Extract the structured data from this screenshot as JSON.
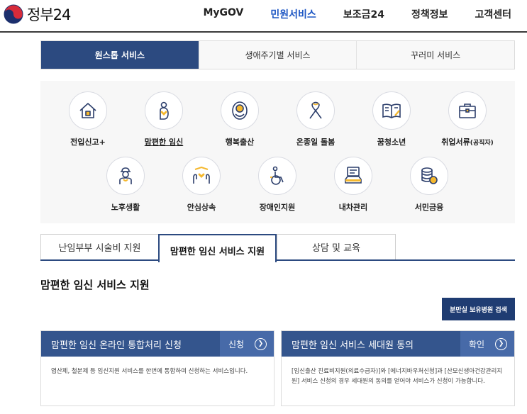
{
  "header": {
    "logo_text": "정부24",
    "nav": [
      "MyGOV",
      "민원서비스",
      "보조금24",
      "정책정보",
      "고객센터"
    ],
    "active_nav": "민원서비스"
  },
  "service_tabs": [
    "원스톱 서비스",
    "생애주기별 서비스",
    "꾸러미 서비스"
  ],
  "icons": [
    {
      "label": "전입신고+",
      "icon": "house-icon"
    },
    {
      "label": "맘편한 임신",
      "icon": "pregnant-icon"
    },
    {
      "label": "행복출산",
      "icon": "baby-icon"
    },
    {
      "label": "온종일 돌봄",
      "icon": "ribbon-icon"
    },
    {
      "label": "꿈청소년",
      "icon": "book-icon"
    },
    {
      "label": "취업서류",
      "label_small": "(공직자)",
      "icon": "briefcase-icon"
    },
    {
      "label": "노후생활",
      "icon": "elder-icon"
    },
    {
      "label": "안심상속",
      "icon": "hands-icon"
    },
    {
      "label": "장애인지원",
      "icon": "wheelchair-icon"
    },
    {
      "label": "내차관리",
      "icon": "car-icon"
    },
    {
      "label": "서민금융",
      "icon": "coins-icon"
    }
  ],
  "sub_tabs": [
    "난임부부 시술비 지원",
    "맘편한 임신 서비스 지원",
    "상담 및 교육"
  ],
  "section_title": "맘편한 임신 서비스 지원",
  "search_button": "분만실 보유병원 검색",
  "cards": [
    {
      "title": "맘편한 임신 온라인 통합처리 신청",
      "action": "신청",
      "desc": "엽산제, 철분제 등 임신지원 서비스를 한번에 통합하여 신청하는 서비스입니다."
    },
    {
      "title": "맘편한 임신 서비스 세대원 동의",
      "action": "확인",
      "desc": "[임신출산 진료비지원(의료수급자)]와 [에너지바우처신청]과 [산모신생아건강관리지원] 서비스 신청의 경우 세대원의 동의를 얻어야 서비스가 신청이 가능합니다."
    }
  ],
  "colors": {
    "primary": "#2c4a80",
    "nav_active": "#1e57c4",
    "card_head": "#34558d",
    "accent": "#f5b82e"
  }
}
